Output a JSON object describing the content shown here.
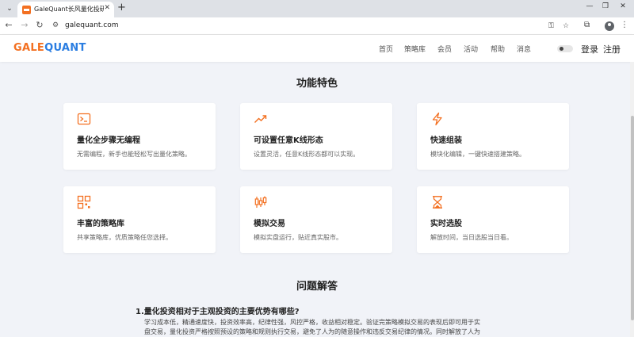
{
  "browser": {
    "tab_title": "GaleQuant长风量化投研平台",
    "url": "galequant.com"
  },
  "site": {
    "logo_gale": "GALE",
    "logo_quant": "QUANT",
    "nav": [
      "首页",
      "策略库",
      "会员",
      "活动",
      "帮助",
      "消息"
    ],
    "login": "登录",
    "register": "注册",
    "brand_orange": "#f37021",
    "brand_blue": "#2a7de1"
  },
  "features": {
    "title": "功能特色",
    "cards": [
      {
        "icon": "terminal-icon",
        "title": "量化全步骤无编程",
        "desc": "无需编程，新手也能轻松写出量化策略。"
      },
      {
        "icon": "trend-up-icon",
        "title": "可设置任意K线形态",
        "desc": "设置灵活，任意K线形态都可以实现。"
      },
      {
        "icon": "lightning-icon",
        "title": "快速组装",
        "desc": "模块化编辑，一键快速搭建策略。"
      },
      {
        "icon": "qrcode-icon",
        "title": "丰富的策略库",
        "desc": "共享策略库，优质策略任您选择。"
      },
      {
        "icon": "candlestick-icon",
        "title": "模拟交易",
        "desc": "模拟实盘运行，贴近真实股市。"
      },
      {
        "icon": "hourglass-icon",
        "title": "实时选股",
        "desc": "解放时间，当日选股当日看。"
      }
    ]
  },
  "faq": {
    "title": "问题解答",
    "q1": "1.量化投资相对于主观投资的主要优势有哪些?",
    "a1_line1": "学习成本低，精通速度快，投资效率高，纪律性强，风控严格，收益相对稳定。验证完策略模拟交易的表现后即可用于实",
    "a1_line2": "盘交易，量化投资严格按照预设的策略和规则执行交易，避免了人为的随意操作和违反交易纪律的情况。同时解放了人为"
  }
}
